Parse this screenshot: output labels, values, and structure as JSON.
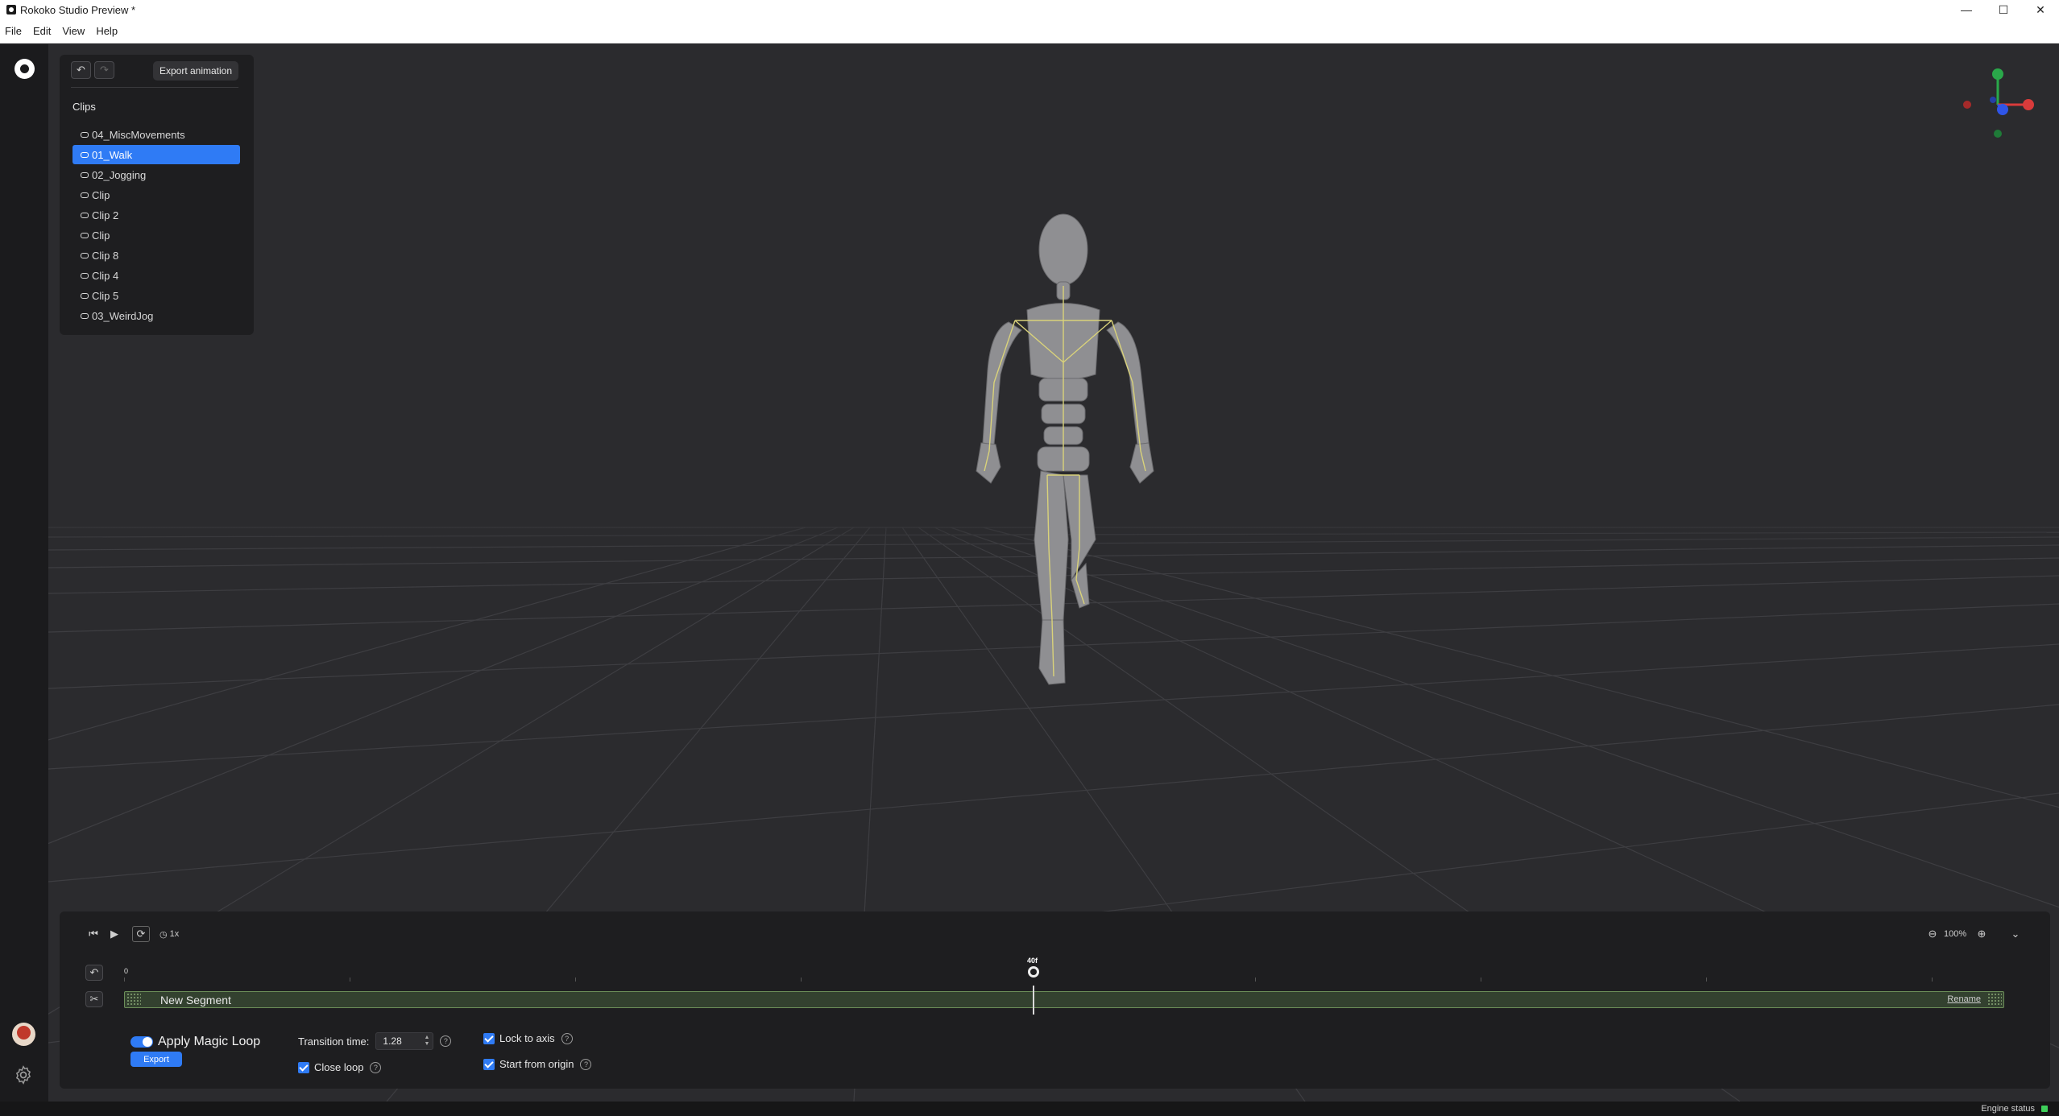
{
  "window": {
    "title": "Rokoko Studio Preview *",
    "minimize": "—",
    "maximize": "☐",
    "close": "✕"
  },
  "menu": [
    "File",
    "Edit",
    "View",
    "Help"
  ],
  "clips_panel": {
    "export_label": "Export animation",
    "title": "Clips",
    "clips": [
      "04_MiscMovements",
      "01_Walk",
      "02_Jogging",
      "Clip",
      "Clip 2",
      "Clip",
      "Clip 8",
      "Clip 4",
      "Clip 5",
      "03_WeirdJog"
    ],
    "selected_index": 1
  },
  "timeline": {
    "speed": "1x",
    "zoom": "100%",
    "start_tick": "0",
    "playhead_label": "40f",
    "segment_name": "New Segment",
    "rename_label": "Rename"
  },
  "magic_loop": {
    "label": "Apply Magic Loop",
    "enabled": true,
    "export_label": "Export",
    "transition_label": "Transition time:",
    "transition_value": "1.28",
    "close_loop": "Close loop",
    "lock_axis": "Lock to axis",
    "start_origin": "Start from origin",
    "help": "?"
  },
  "status": {
    "engine": "Engine status"
  },
  "colors": {
    "accent": "#2f7bf5",
    "segment": "#33412f",
    "engine_ok": "#3ecf5a"
  }
}
